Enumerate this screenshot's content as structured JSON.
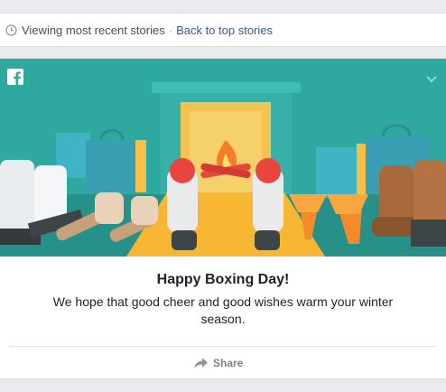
{
  "status_bar": {
    "text": "Viewing most recent stories",
    "separator": "·",
    "link": "Back to top stories"
  },
  "card": {
    "title": "Happy Boxing Day!",
    "body": "We hope that good cheer and good wishes warm your winter season.",
    "share_label": "Share"
  },
  "icons": {
    "status": "clock-icon",
    "brand": "facebook-logo-icon",
    "menu": "chevron-down-icon",
    "share": "share-arrow-icon"
  },
  "colors": {
    "link": "#365899",
    "banner_bg": "#2a9d96",
    "rug": "#f7b733",
    "text": "#1d2129",
    "muted": "#7f7f7f"
  }
}
